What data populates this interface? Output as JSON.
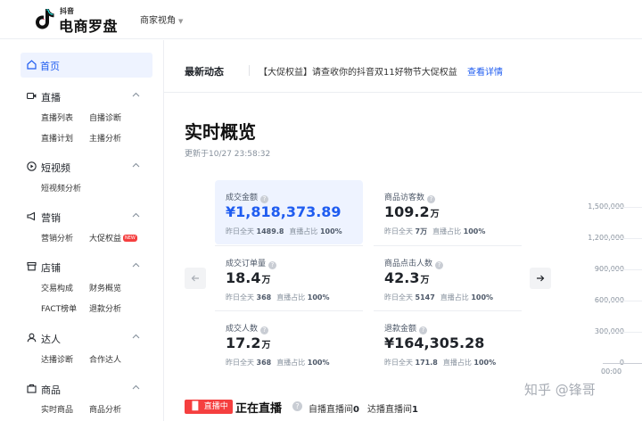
{
  "header": {
    "brand_small": "抖音",
    "brand_name": "电商罗盘",
    "view_switch": "商家视角"
  },
  "sidebar": {
    "home": "首页",
    "groups": [
      {
        "title": "直播",
        "items": [
          "直播列表",
          "自播诊断",
          "直播计划",
          "主播分析"
        ]
      },
      {
        "title": "短视频",
        "items": [
          "短视频分析"
        ]
      },
      {
        "title": "营销",
        "items": [
          "营销分析",
          "大促权益"
        ],
        "badge": "NEW"
      },
      {
        "title": "店铺",
        "items": [
          "交易构成",
          "财务概览",
          "FACT榜单",
          "退款分析"
        ]
      },
      {
        "title": "达人",
        "items": [
          "达播诊断",
          "合作达人"
        ]
      },
      {
        "title": "商品",
        "items": [
          "实时商品",
          "商品分析"
        ]
      }
    ]
  },
  "news": {
    "label": "最新动态",
    "text": "【大促权益】请查收你的抖音双11好物节大促权益",
    "link": "查看详情"
  },
  "overview": {
    "title": "实时概览",
    "updated": "更新于10/27 23:58:32",
    "cards": [
      {
        "label": "成交金额",
        "value": "¥1,818,373.89",
        "unit": "",
        "foot_label": "昨日全天",
        "foot_value": "1489.8",
        "share_label": "直播占比",
        "share_value": "100%"
      },
      {
        "label": "商品访客数",
        "value": "109.2",
        "unit": "万",
        "foot_label": "昨日全天",
        "foot_value": "7万",
        "share_label": "直播占比",
        "share_value": "100%"
      },
      {
        "label": "成交订单量",
        "value": "18.4",
        "unit": "万",
        "foot_label": "昨日全天",
        "foot_value": "368",
        "share_label": "直播占比",
        "share_value": "100%"
      },
      {
        "label": "商品点击人数",
        "value": "42.3",
        "unit": "万",
        "foot_label": "昨日全天",
        "foot_value": "5147",
        "share_label": "直播占比",
        "share_value": "100%"
      },
      {
        "label": "成交人数",
        "value": "17.2",
        "unit": "万",
        "foot_label": "昨日全天",
        "foot_value": "368",
        "share_label": "直播占比",
        "share_value": "100%"
      },
      {
        "label": "退款金额",
        "value": "¥164,305.28",
        "unit": "",
        "foot_label": "昨日全天",
        "foot_value": "171.8",
        "share_label": "直播占比",
        "share_value": "100%"
      }
    ]
  },
  "chart": {
    "y_ticks": [
      "1,500,000",
      "1,200,000",
      "900,000",
      "600,000",
      "300,000",
      "0"
    ],
    "x_first": "00:00"
  },
  "watermark": "知乎 @锋哥",
  "live": {
    "badge": "直播中",
    "title": "正在直播",
    "self_label": "自播直播间",
    "self_count": "0",
    "talent_label": "达播直播间",
    "talent_count": "1"
  },
  "colors": {
    "accent": "#1f5cf0",
    "live_red": "#f53f3f"
  }
}
